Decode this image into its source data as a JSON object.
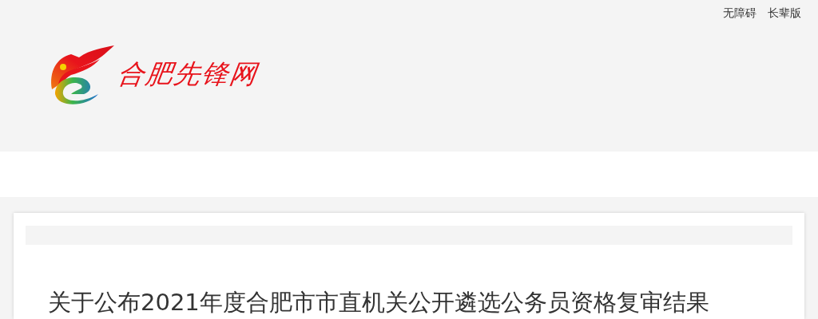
{
  "top_links": [
    "无障碍",
    "长辈版"
  ],
  "logo": {
    "text": "合肥先锋网"
  },
  "article": {
    "title": "关于公布2021年度合肥市市直机关公开遴选公务员资格复审结果"
  }
}
